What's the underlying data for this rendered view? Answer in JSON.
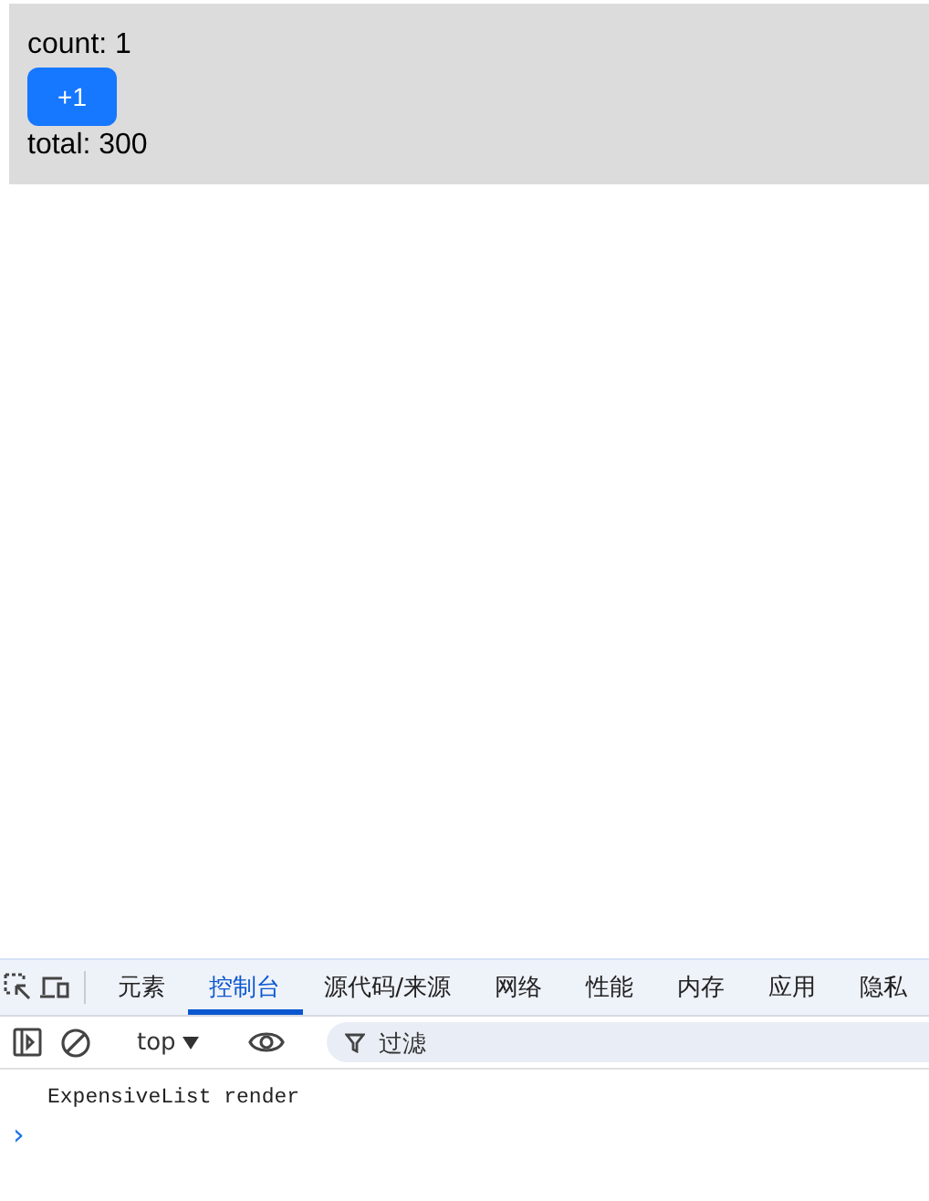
{
  "app": {
    "count_label": "count: 1",
    "button": "+1",
    "total_label": "total: 300"
  },
  "devtools": {
    "tabs": [
      {
        "label": "元素",
        "selected": false
      },
      {
        "label": "控制台",
        "selected": true
      },
      {
        "label": "源代码/来源",
        "selected": false
      },
      {
        "label": "网络",
        "selected": false
      },
      {
        "label": "性能",
        "selected": false
      },
      {
        "label": "内存",
        "selected": false
      },
      {
        "label": "应用",
        "selected": false
      },
      {
        "label": "隐私",
        "selected": false
      }
    ],
    "context": "top",
    "filter": {
      "placeholder": "过滤"
    },
    "console_lines": [
      "ExpensiveList render"
    ],
    "prompt": "›"
  }
}
